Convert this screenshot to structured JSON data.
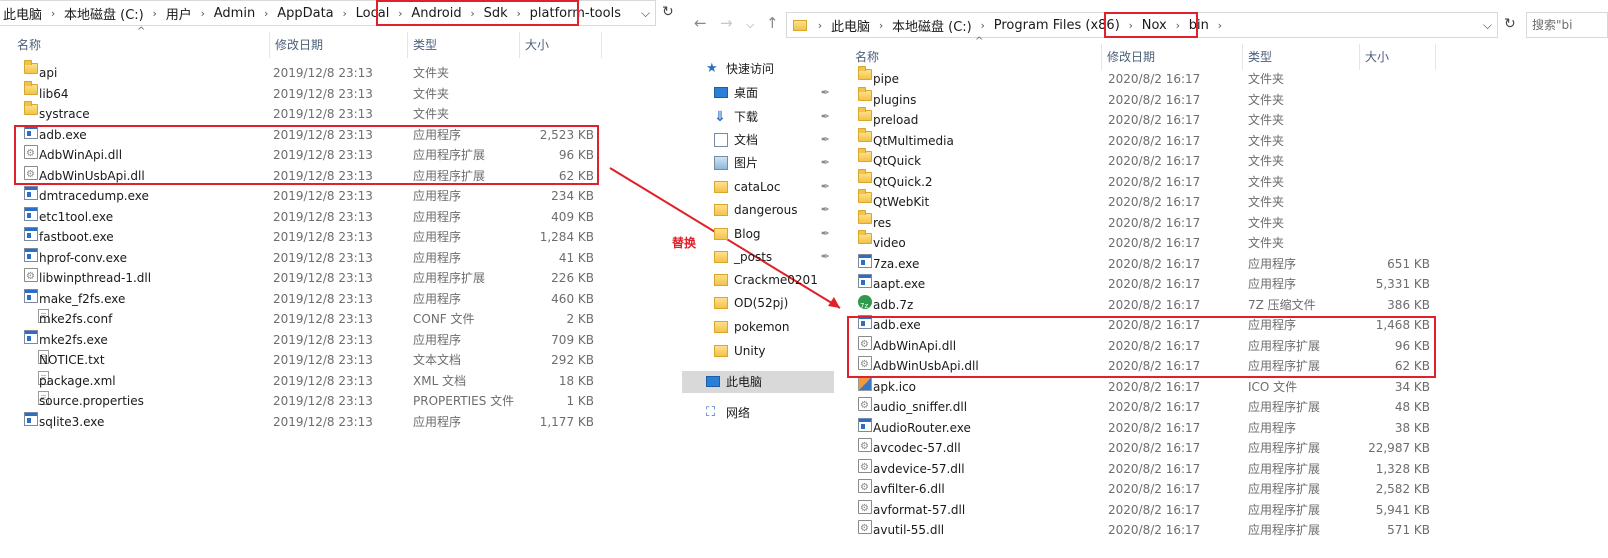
{
  "left": {
    "breadcrumb": [
      "此电脑",
      "本地磁盘 (C:)",
      "用户",
      "Admin",
      "AppData",
      "Local",
      "Android",
      "Sdk",
      "platform-tools"
    ],
    "headers": {
      "name": "名称",
      "date": "修改日期",
      "type": "类型",
      "size": "大小"
    },
    "files": [
      {
        "name": "api",
        "date": "2019/12/8 23:13",
        "type": "文件夹",
        "size": "",
        "icon": "folder-icon"
      },
      {
        "name": "lib64",
        "date": "2019/12/8 23:13",
        "type": "文件夹",
        "size": "",
        "icon": "folder-icon"
      },
      {
        "name": "systrace",
        "date": "2019/12/8 23:13",
        "type": "文件夹",
        "size": "",
        "icon": "folder-icon"
      },
      {
        "name": "adb.exe",
        "date": "2019/12/8 23:13",
        "type": "应用程序",
        "size": "2,523 KB",
        "icon": "exe-icon"
      },
      {
        "name": "AdbWinApi.dll",
        "date": "2019/12/8 23:13",
        "type": "应用程序扩展",
        "size": "96 KB",
        "icon": "dll-icon"
      },
      {
        "name": "AdbWinUsbApi.dll",
        "date": "2019/12/8 23:13",
        "type": "应用程序扩展",
        "size": "62 KB",
        "icon": "dll-icon"
      },
      {
        "name": "dmtracedump.exe",
        "date": "2019/12/8 23:13",
        "type": "应用程序",
        "size": "234 KB",
        "icon": "exe-icon"
      },
      {
        "name": "etc1tool.exe",
        "date": "2019/12/8 23:13",
        "type": "应用程序",
        "size": "409 KB",
        "icon": "exe-icon"
      },
      {
        "name": "fastboot.exe",
        "date": "2019/12/8 23:13",
        "type": "应用程序",
        "size": "1,284 KB",
        "icon": "exe-icon"
      },
      {
        "name": "hprof-conv.exe",
        "date": "2019/12/8 23:13",
        "type": "应用程序",
        "size": "41 KB",
        "icon": "exe-icon"
      },
      {
        "name": "libwinpthread-1.dll",
        "date": "2019/12/8 23:13",
        "type": "应用程序扩展",
        "size": "226 KB",
        "icon": "dll-icon"
      },
      {
        "name": "make_f2fs.exe",
        "date": "2019/12/8 23:13",
        "type": "应用程序",
        "size": "460 KB",
        "icon": "exe-icon"
      },
      {
        "name": "mke2fs.conf",
        "date": "2019/12/8 23:13",
        "type": "CONF 文件",
        "size": "2 KB",
        "icon": "file-icon"
      },
      {
        "name": "mke2fs.exe",
        "date": "2019/12/8 23:13",
        "type": "应用程序",
        "size": "709 KB",
        "icon": "exe-icon"
      },
      {
        "name": "NOTICE.txt",
        "date": "2019/12/8 23:13",
        "type": "文本文档",
        "size": "292 KB",
        "icon": "file-icon"
      },
      {
        "name": "package.xml",
        "date": "2019/12/8 23:13",
        "type": "XML 文档",
        "size": "18 KB",
        "icon": "file-icon"
      },
      {
        "name": "source.properties",
        "date": "2019/12/8 23:13",
        "type": "PROPERTIES 文件",
        "size": "1 KB",
        "icon": "file-icon"
      },
      {
        "name": "sqlite3.exe",
        "date": "2019/12/8 23:13",
        "type": "应用程序",
        "size": "1,177 KB",
        "icon": "exe-icon"
      }
    ]
  },
  "annotation": "替换",
  "right": {
    "breadcrumb": [
      "此电脑",
      "本地磁盘 (C:)",
      "Program Files (x86)",
      "Nox",
      "bin"
    ],
    "search_placeholder": "搜索\"bi",
    "headers": {
      "name": "名称",
      "date": "修改日期",
      "type": "类型",
      "size": "大小"
    },
    "nav": [
      {
        "label": "快速访问",
        "icon": "star-icon",
        "pinned": false
      },
      {
        "label": "桌面",
        "icon": "desktop-icon",
        "pinned": true
      },
      {
        "label": "下载",
        "icon": "download-icon",
        "pinned": true
      },
      {
        "label": "文档",
        "icon": "document-icon",
        "pinned": true
      },
      {
        "label": "图片",
        "icon": "picture-icon",
        "pinned": true
      },
      {
        "label": "cataLoc",
        "icon": "folder-icon",
        "pinned": true
      },
      {
        "label": "dangerous",
        "icon": "folder-icon",
        "pinned": true
      },
      {
        "label": "Blog",
        "icon": "folder-icon",
        "pinned": true
      },
      {
        "label": "_posts",
        "icon": "folder-icon",
        "pinned": true
      },
      {
        "label": "Crackme0201",
        "icon": "folder-icon",
        "pinned": false
      },
      {
        "label": "OD(52pj)",
        "icon": "folder-icon",
        "pinned": false
      },
      {
        "label": "pokemon",
        "icon": "folder-icon",
        "pinned": false
      },
      {
        "label": "Unity",
        "icon": "folder-icon",
        "pinned": false
      },
      {
        "label": "此电脑",
        "icon": "computer-icon",
        "pinned": false
      },
      {
        "label": "网络",
        "icon": "network-icon",
        "pinned": false
      }
    ],
    "files": [
      {
        "name": "pipe",
        "date": "2020/8/2 16:17",
        "type": "文件夹",
        "size": "",
        "icon": "folder-icon"
      },
      {
        "name": "plugins",
        "date": "2020/8/2 16:17",
        "type": "文件夹",
        "size": "",
        "icon": "folder-icon"
      },
      {
        "name": "preload",
        "date": "2020/8/2 16:17",
        "type": "文件夹",
        "size": "",
        "icon": "folder-icon"
      },
      {
        "name": "QtMultimedia",
        "date": "2020/8/2 16:17",
        "type": "文件夹",
        "size": "",
        "icon": "folder-icon"
      },
      {
        "name": "QtQuick",
        "date": "2020/8/2 16:17",
        "type": "文件夹",
        "size": "",
        "icon": "folder-icon"
      },
      {
        "name": "QtQuick.2",
        "date": "2020/8/2 16:17",
        "type": "文件夹",
        "size": "",
        "icon": "folder-icon"
      },
      {
        "name": "QtWebKit",
        "date": "2020/8/2 16:17",
        "type": "文件夹",
        "size": "",
        "icon": "folder-icon"
      },
      {
        "name": "res",
        "date": "2020/8/2 16:17",
        "type": "文件夹",
        "size": "",
        "icon": "folder-icon"
      },
      {
        "name": "video",
        "date": "2020/8/2 16:17",
        "type": "文件夹",
        "size": "",
        "icon": "folder-icon"
      },
      {
        "name": "7za.exe",
        "date": "2020/8/2 16:17",
        "type": "应用程序",
        "size": "651 KB",
        "icon": "exe-icon"
      },
      {
        "name": "aapt.exe",
        "date": "2020/8/2 16:17",
        "type": "应用程序",
        "size": "5,331 KB",
        "icon": "exe-icon"
      },
      {
        "name": "adb.7z",
        "date": "2020/8/2 16:17",
        "type": "7Z 压缩文件",
        "size": "386 KB",
        "icon": "archive-icon"
      },
      {
        "name": "adb.exe",
        "date": "2020/8/2 16:17",
        "type": "应用程序",
        "size": "1,468 KB",
        "icon": "exe-icon"
      },
      {
        "name": "AdbWinApi.dll",
        "date": "2020/8/2 16:17",
        "type": "应用程序扩展",
        "size": "96 KB",
        "icon": "dll-icon"
      },
      {
        "name": "AdbWinUsbApi.dll",
        "date": "2020/8/2 16:17",
        "type": "应用程序扩展",
        "size": "62 KB",
        "icon": "dll-icon"
      },
      {
        "name": "apk.ico",
        "date": "2020/8/2 16:17",
        "type": "ICO 文件",
        "size": "34 KB",
        "icon": "image-icon"
      },
      {
        "name": "audio_sniffer.dll",
        "date": "2020/8/2 16:17",
        "type": "应用程序扩展",
        "size": "48 KB",
        "icon": "dll-icon"
      },
      {
        "name": "AudioRouter.exe",
        "date": "2020/8/2 16:17",
        "type": "应用程序",
        "size": "38 KB",
        "icon": "exe-icon"
      },
      {
        "name": "avcodec-57.dll",
        "date": "2020/8/2 16:17",
        "type": "应用程序扩展",
        "size": "22,987 KB",
        "icon": "dll-icon"
      },
      {
        "name": "avdevice-57.dll",
        "date": "2020/8/2 16:17",
        "type": "应用程序扩展",
        "size": "1,328 KB",
        "icon": "dll-icon"
      },
      {
        "name": "avfilter-6.dll",
        "date": "2020/8/2 16:17",
        "type": "应用程序扩展",
        "size": "2,582 KB",
        "icon": "dll-icon"
      },
      {
        "name": "avformat-57.dll",
        "date": "2020/8/2 16:17",
        "type": "应用程序扩展",
        "size": "5,941 KB",
        "icon": "dll-icon"
      },
      {
        "name": "avutil-55.dll",
        "date": "2020/8/2 16:17",
        "type": "应用程序扩展",
        "size": "571 KB",
        "icon": "dll-icon"
      }
    ]
  },
  "colors": {
    "highlight": "#e0202a",
    "header_text": "#4c607a",
    "selection": "#d9d9d9"
  }
}
